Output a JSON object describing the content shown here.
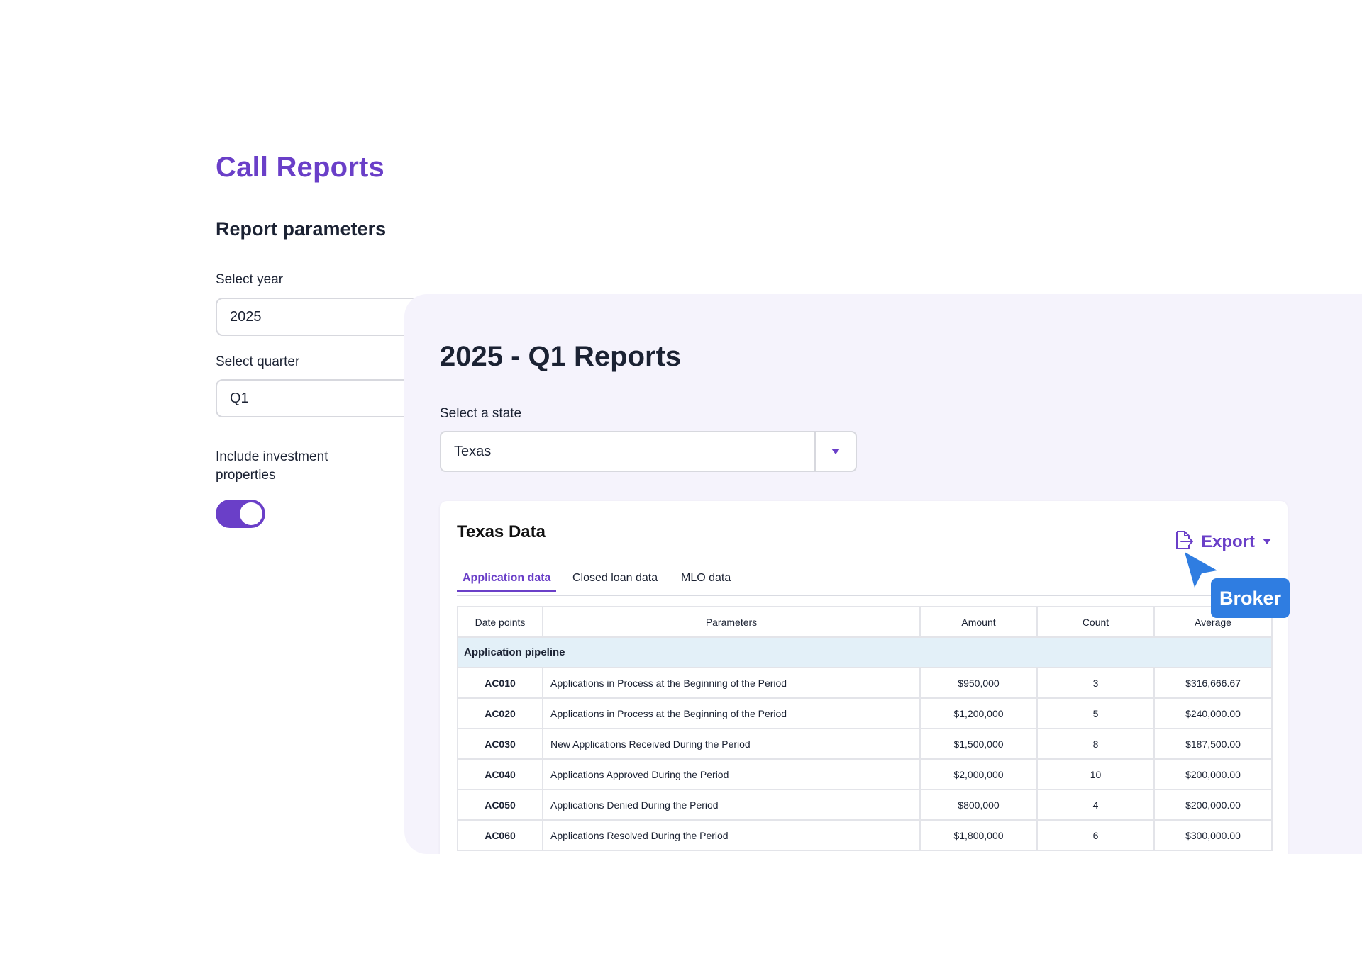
{
  "page": {
    "title": "Call Reports",
    "section_title": "Report parameters"
  },
  "parameters": {
    "year_label": "Select year",
    "year_value": "2025",
    "quarter_label": "Select quarter",
    "quarter_value": "Q1",
    "investment_label": "Include investment properties",
    "investment_enabled": true
  },
  "panel": {
    "title": "2025 - Q1 Reports",
    "state_label": "Select a state",
    "state_value": "Texas"
  },
  "card": {
    "title": "Texas Data",
    "export_label": "Export",
    "tabs": [
      {
        "label": "Application data",
        "active": true
      },
      {
        "label": "Closed loan data",
        "active": false
      },
      {
        "label": "MLO data",
        "active": false
      }
    ]
  },
  "table": {
    "headers": [
      "Date points",
      "Parameters",
      "Amount",
      "Count",
      "Average"
    ],
    "group_label": "Application pipeline",
    "rows": [
      {
        "code": "AC010",
        "parameter": "Applications in Process at the Beginning of the Period",
        "amount": "$950,000",
        "count": "3",
        "average": "$316,666.67"
      },
      {
        "code": "AC020",
        "parameter": "Applications in Process at the Beginning of the Period",
        "amount": "$1,200,000",
        "count": "5",
        "average": "$240,000.00"
      },
      {
        "code": "AC030",
        "parameter": "New Applications Received During the Period",
        "amount": "$1,500,000",
        "count": "8",
        "average": "$187,500.00"
      },
      {
        "code": "AC040",
        "parameter": "Applications Approved During the Period",
        "amount": "$2,000,000",
        "count": "10",
        "average": "$200,000.00"
      },
      {
        "code": "AC050",
        "parameter": "Applications Denied During the Period",
        "amount": "$800,000",
        "count": "4",
        "average": "$200,000.00"
      },
      {
        "code": "AC060",
        "parameter": "Applications Resolved During the Period",
        "amount": "$1,800,000",
        "count": "6",
        "average": "$300,000.00"
      }
    ]
  },
  "cursor_tag": "Broker",
  "colors": {
    "accent": "#6a3fc8",
    "panel_bg": "#f5f3fc",
    "group_row_bg": "#e3f0f8",
    "cursor_blue": "#2f7de1"
  },
  "icons": {
    "export": "export-file-icon",
    "dropdown": "chevron-down-icon",
    "cursor": "pointer-cursor-icon"
  }
}
